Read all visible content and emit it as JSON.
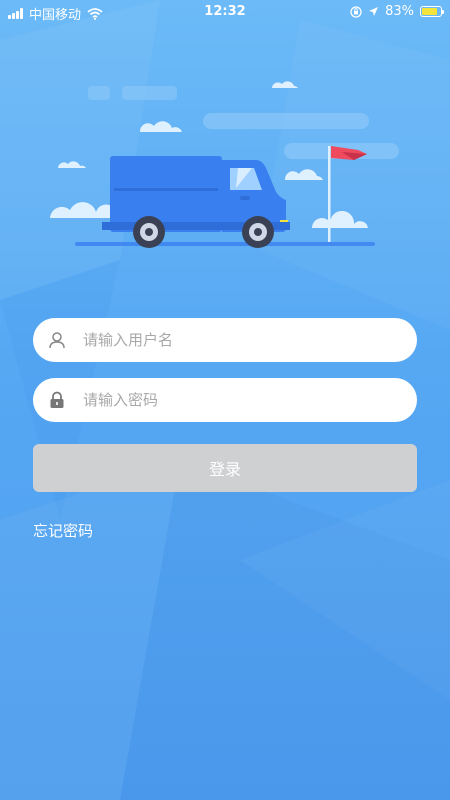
{
  "status_bar": {
    "carrier": "中国移动",
    "time": "12:32",
    "battery_percent": "83%",
    "battery_level": 0.83,
    "icons": [
      "signal-icon",
      "wifi-icon",
      "rotation-lock-icon",
      "location-arrow-icon",
      "battery-icon"
    ]
  },
  "illustration": {
    "subject": "delivery-truck",
    "truck_color": "#3a7ff0",
    "flag_color": "#f04a5e"
  },
  "login_form": {
    "username_placeholder": "请输入用户名",
    "username_value": "",
    "password_placeholder": "请输入密码",
    "password_value": "",
    "login_label": "登录",
    "forgot_password_label": "忘记密码"
  },
  "colors": {
    "background_top": "#6cbaf7",
    "background_bottom": "#4d9cee",
    "button_disabled": "#cfd0d2",
    "battery_fill": "#f3e33a"
  }
}
